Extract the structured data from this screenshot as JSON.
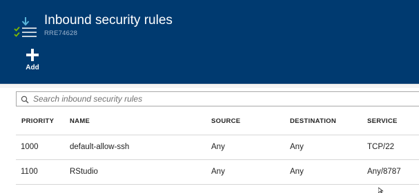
{
  "header": {
    "title": "Inbound security rules",
    "subtitle": "RRE74628",
    "add_label": "Add",
    "icon": "security-rules-icon",
    "colors": {
      "background": "#003a70",
      "icon_green": "#7fba00",
      "icon_blue": "#59b4d9"
    }
  },
  "search": {
    "placeholder": "Search inbound security rules",
    "value": ""
  },
  "table": {
    "columns": {
      "priority": "PRIORITY",
      "name": "NAME",
      "source": "SOURCE",
      "destination": "DESTINATION",
      "service": "SERVICE"
    },
    "rows": [
      {
        "priority": "1000",
        "name": "default-allow-ssh",
        "source": "Any",
        "destination": "Any",
        "service": "TCP/22"
      },
      {
        "priority": "1100",
        "name": "RStudio",
        "source": "Any",
        "destination": "Any",
        "service": "Any/8787"
      }
    ]
  }
}
